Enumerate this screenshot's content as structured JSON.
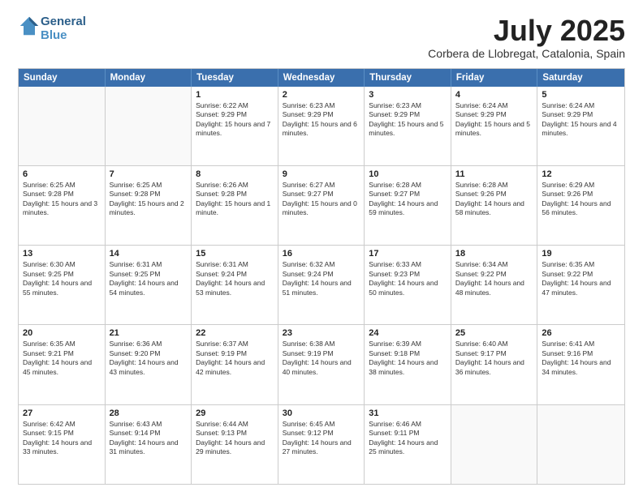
{
  "header": {
    "logo_line1": "General",
    "logo_line2": "Blue",
    "month": "July 2025",
    "location": "Corbera de Llobregat, Catalonia, Spain"
  },
  "days_of_week": [
    "Sunday",
    "Monday",
    "Tuesday",
    "Wednesday",
    "Thursday",
    "Friday",
    "Saturday"
  ],
  "weeks": [
    [
      {
        "day": "",
        "sunrise": "",
        "sunset": "",
        "daylight": ""
      },
      {
        "day": "",
        "sunrise": "",
        "sunset": "",
        "daylight": ""
      },
      {
        "day": "1",
        "sunrise": "Sunrise: 6:22 AM",
        "sunset": "Sunset: 9:29 PM",
        "daylight": "Daylight: 15 hours and 7 minutes."
      },
      {
        "day": "2",
        "sunrise": "Sunrise: 6:23 AM",
        "sunset": "Sunset: 9:29 PM",
        "daylight": "Daylight: 15 hours and 6 minutes."
      },
      {
        "day": "3",
        "sunrise": "Sunrise: 6:23 AM",
        "sunset": "Sunset: 9:29 PM",
        "daylight": "Daylight: 15 hours and 5 minutes."
      },
      {
        "day": "4",
        "sunrise": "Sunrise: 6:24 AM",
        "sunset": "Sunset: 9:29 PM",
        "daylight": "Daylight: 15 hours and 5 minutes."
      },
      {
        "day": "5",
        "sunrise": "Sunrise: 6:24 AM",
        "sunset": "Sunset: 9:29 PM",
        "daylight": "Daylight: 15 hours and 4 minutes."
      }
    ],
    [
      {
        "day": "6",
        "sunrise": "Sunrise: 6:25 AM",
        "sunset": "Sunset: 9:28 PM",
        "daylight": "Daylight: 15 hours and 3 minutes."
      },
      {
        "day": "7",
        "sunrise": "Sunrise: 6:25 AM",
        "sunset": "Sunset: 9:28 PM",
        "daylight": "Daylight: 15 hours and 2 minutes."
      },
      {
        "day": "8",
        "sunrise": "Sunrise: 6:26 AM",
        "sunset": "Sunset: 9:28 PM",
        "daylight": "Daylight: 15 hours and 1 minute."
      },
      {
        "day": "9",
        "sunrise": "Sunrise: 6:27 AM",
        "sunset": "Sunset: 9:27 PM",
        "daylight": "Daylight: 15 hours and 0 minutes."
      },
      {
        "day": "10",
        "sunrise": "Sunrise: 6:28 AM",
        "sunset": "Sunset: 9:27 PM",
        "daylight": "Daylight: 14 hours and 59 minutes."
      },
      {
        "day": "11",
        "sunrise": "Sunrise: 6:28 AM",
        "sunset": "Sunset: 9:26 PM",
        "daylight": "Daylight: 14 hours and 58 minutes."
      },
      {
        "day": "12",
        "sunrise": "Sunrise: 6:29 AM",
        "sunset": "Sunset: 9:26 PM",
        "daylight": "Daylight: 14 hours and 56 minutes."
      }
    ],
    [
      {
        "day": "13",
        "sunrise": "Sunrise: 6:30 AM",
        "sunset": "Sunset: 9:25 PM",
        "daylight": "Daylight: 14 hours and 55 minutes."
      },
      {
        "day": "14",
        "sunrise": "Sunrise: 6:31 AM",
        "sunset": "Sunset: 9:25 PM",
        "daylight": "Daylight: 14 hours and 54 minutes."
      },
      {
        "day": "15",
        "sunrise": "Sunrise: 6:31 AM",
        "sunset": "Sunset: 9:24 PM",
        "daylight": "Daylight: 14 hours and 53 minutes."
      },
      {
        "day": "16",
        "sunrise": "Sunrise: 6:32 AM",
        "sunset": "Sunset: 9:24 PM",
        "daylight": "Daylight: 14 hours and 51 minutes."
      },
      {
        "day": "17",
        "sunrise": "Sunrise: 6:33 AM",
        "sunset": "Sunset: 9:23 PM",
        "daylight": "Daylight: 14 hours and 50 minutes."
      },
      {
        "day": "18",
        "sunrise": "Sunrise: 6:34 AM",
        "sunset": "Sunset: 9:22 PM",
        "daylight": "Daylight: 14 hours and 48 minutes."
      },
      {
        "day": "19",
        "sunrise": "Sunrise: 6:35 AM",
        "sunset": "Sunset: 9:22 PM",
        "daylight": "Daylight: 14 hours and 47 minutes."
      }
    ],
    [
      {
        "day": "20",
        "sunrise": "Sunrise: 6:35 AM",
        "sunset": "Sunset: 9:21 PM",
        "daylight": "Daylight: 14 hours and 45 minutes."
      },
      {
        "day": "21",
        "sunrise": "Sunrise: 6:36 AM",
        "sunset": "Sunset: 9:20 PM",
        "daylight": "Daylight: 14 hours and 43 minutes."
      },
      {
        "day": "22",
        "sunrise": "Sunrise: 6:37 AM",
        "sunset": "Sunset: 9:19 PM",
        "daylight": "Daylight: 14 hours and 42 minutes."
      },
      {
        "day": "23",
        "sunrise": "Sunrise: 6:38 AM",
        "sunset": "Sunset: 9:19 PM",
        "daylight": "Daylight: 14 hours and 40 minutes."
      },
      {
        "day": "24",
        "sunrise": "Sunrise: 6:39 AM",
        "sunset": "Sunset: 9:18 PM",
        "daylight": "Daylight: 14 hours and 38 minutes."
      },
      {
        "day": "25",
        "sunrise": "Sunrise: 6:40 AM",
        "sunset": "Sunset: 9:17 PM",
        "daylight": "Daylight: 14 hours and 36 minutes."
      },
      {
        "day": "26",
        "sunrise": "Sunrise: 6:41 AM",
        "sunset": "Sunset: 9:16 PM",
        "daylight": "Daylight: 14 hours and 34 minutes."
      }
    ],
    [
      {
        "day": "27",
        "sunrise": "Sunrise: 6:42 AM",
        "sunset": "Sunset: 9:15 PM",
        "daylight": "Daylight: 14 hours and 33 minutes."
      },
      {
        "day": "28",
        "sunrise": "Sunrise: 6:43 AM",
        "sunset": "Sunset: 9:14 PM",
        "daylight": "Daylight: 14 hours and 31 minutes."
      },
      {
        "day": "29",
        "sunrise": "Sunrise: 6:44 AM",
        "sunset": "Sunset: 9:13 PM",
        "daylight": "Daylight: 14 hours and 29 minutes."
      },
      {
        "day": "30",
        "sunrise": "Sunrise: 6:45 AM",
        "sunset": "Sunset: 9:12 PM",
        "daylight": "Daylight: 14 hours and 27 minutes."
      },
      {
        "day": "31",
        "sunrise": "Sunrise: 6:46 AM",
        "sunset": "Sunset: 9:11 PM",
        "daylight": "Daylight: 14 hours and 25 minutes."
      },
      {
        "day": "",
        "sunrise": "",
        "sunset": "",
        "daylight": ""
      },
      {
        "day": "",
        "sunrise": "",
        "sunset": "",
        "daylight": ""
      }
    ]
  ]
}
